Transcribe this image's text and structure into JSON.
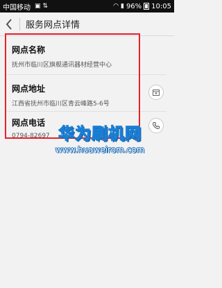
{
  "status_bar": {
    "carrier": "中国移动",
    "battery": "96%",
    "time": "10:05"
  },
  "title_bar": {
    "title": "服务网点详情"
  },
  "detail": {
    "name_label": "网点名称",
    "name_value": "抚州市临川区旗舰通讯器材经营中心",
    "address_label": "网点地址",
    "address_value": "江西省抚州市临川区青云峰路5-6号",
    "phone_label": "网点电话",
    "phone_value": "0794-82697"
  },
  "watermark": {
    "title": "华为刷机网",
    "url": "www.huaweirom.com"
  }
}
